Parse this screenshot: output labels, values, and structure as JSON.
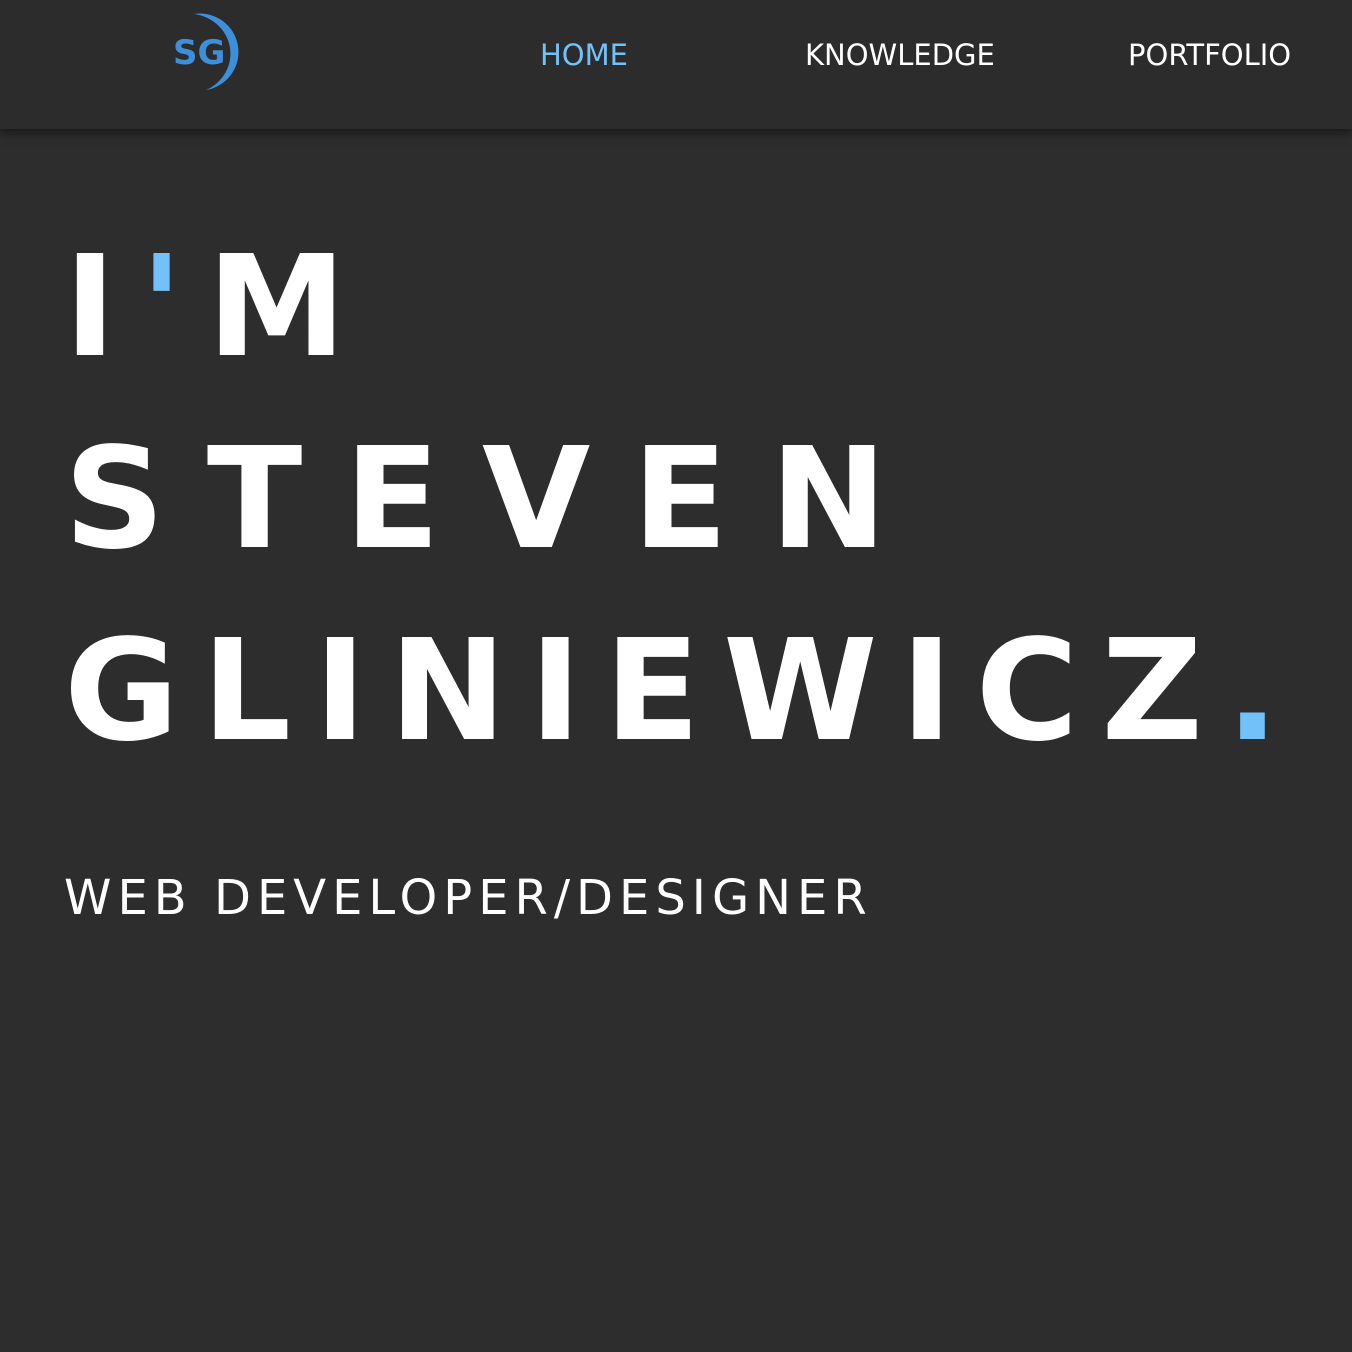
{
  "colors": {
    "background": "#2d2d2d",
    "navbar": "#2c2c2c",
    "text": "#ffffff",
    "accent": "#72c1f9",
    "logo": "#3d8fdb"
  },
  "logo": {
    "text": "SG",
    "icon": "sg-logo-crescent"
  },
  "nav": {
    "items": [
      {
        "label": "HOME",
        "active": true
      },
      {
        "label": "KNOWLEDGE",
        "active": false
      },
      {
        "label": "PORTFOLIO",
        "active": false
      }
    ]
  },
  "hero": {
    "line1_first": "I",
    "line1_accent": "'",
    "line1_last": "M",
    "line2": "STEVEN",
    "line3": "GLINIEWICZ",
    "line3_accent": ".",
    "subtitle": "WEB DEVELOPER/DESIGNER"
  }
}
